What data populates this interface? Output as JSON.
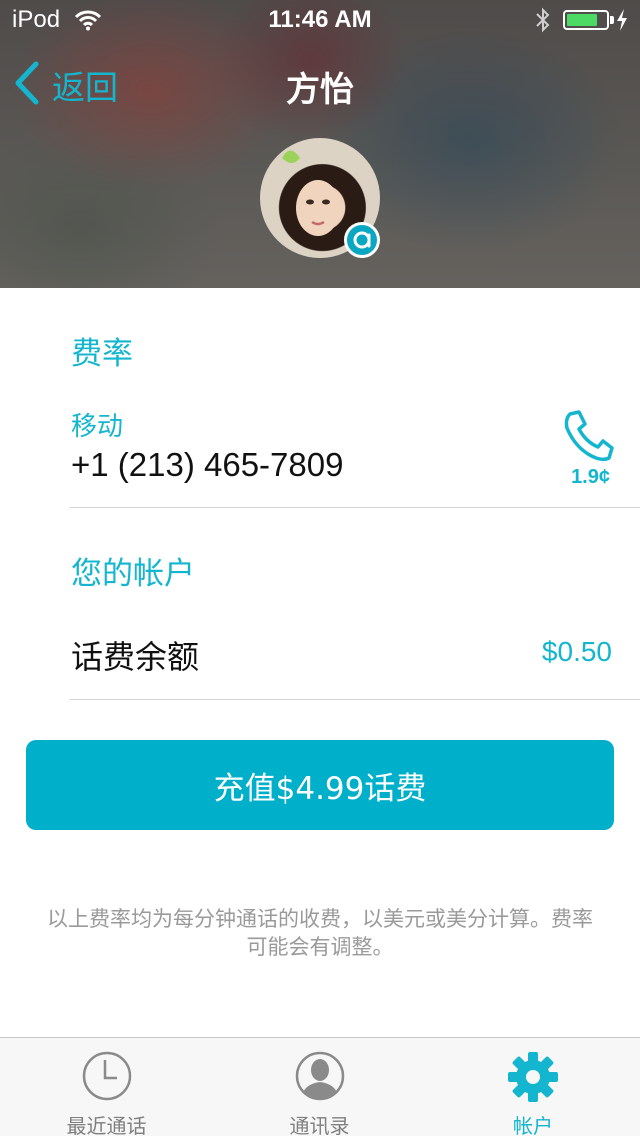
{
  "status_bar": {
    "carrier": "iPod",
    "time": "11:46 AM",
    "battery_level": 0.8,
    "icons": [
      "wifi-icon",
      "bluetooth-icon",
      "battery-icon",
      "charging-icon"
    ]
  },
  "nav": {
    "back_label": "返回",
    "title": "方怡"
  },
  "profile": {
    "avatar": "contact-avatar",
    "badge_icon": "app-badge-icon"
  },
  "rates": {
    "section_title": "费率",
    "type": "移动",
    "phone_number": "+1 (213) 465-7809",
    "call_rate": "1.9¢",
    "call_icon": "phone-icon"
  },
  "account": {
    "section_title": "您的帐户",
    "balance_label": "话费余额",
    "balance_value": "$0.50"
  },
  "topup_button": "充值$4.99话费",
  "footnote": "以上费率均为每分钟通话的收费，以美元或美分计算。费率可能会有调整。",
  "tabs": [
    {
      "label": "最近通话",
      "icon": "clock-icon",
      "active": false
    },
    {
      "label": "通讯录",
      "icon": "contacts-icon",
      "active": false
    },
    {
      "label": "帐户",
      "icon": "gear-icon",
      "active": true
    }
  ],
  "colors": {
    "accent": "#14b6cf",
    "button": "#00afc9",
    "footnote": "#9a9a9a"
  }
}
